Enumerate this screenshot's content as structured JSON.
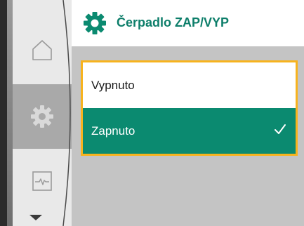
{
  "header": {
    "title": "Čerpadlo ZAP/VYP",
    "icon": "gear-icon"
  },
  "sidebar": {
    "items": [
      {
        "name": "home",
        "icon": "home-icon",
        "active": false
      },
      {
        "name": "settings",
        "icon": "gear-icon",
        "active": true
      },
      {
        "name": "monitoring",
        "icon": "pulse-monitor-icon",
        "active": false
      }
    ]
  },
  "options": [
    {
      "label": "Vypnuto",
      "selected": false
    },
    {
      "label": "Zapnuto",
      "selected": true
    }
  ],
  "colors": {
    "accent": "#0b8a70",
    "focus_border": "#f7b31e",
    "title": "#0d7e6a"
  }
}
